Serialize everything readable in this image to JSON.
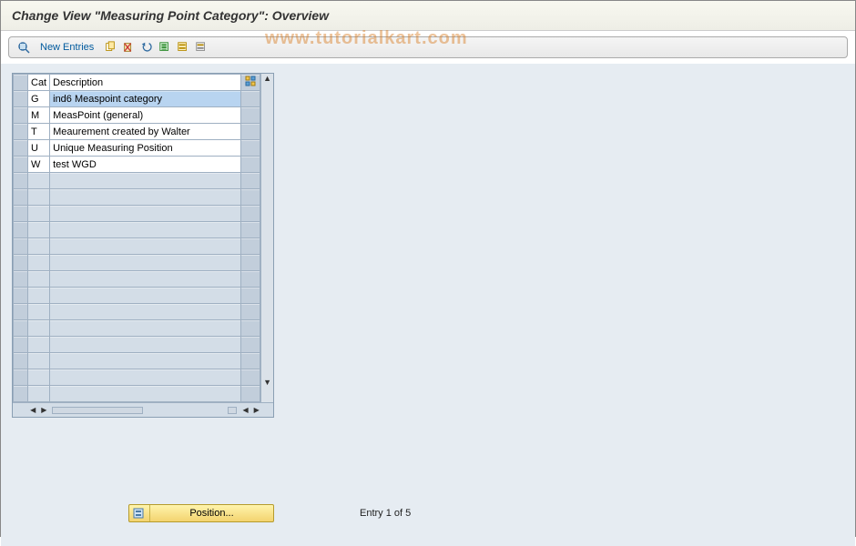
{
  "header": {
    "title": "Change View \"Measuring Point Category\": Overview"
  },
  "toolbar": {
    "new_entries_label": "New Entries",
    "icons": {
      "detail": "detail-icon",
      "copy": "copy-icon",
      "delete": "delete-icon",
      "undo": "undo-icon",
      "select_all": "select-all-icon",
      "select_block": "select-block-icon",
      "deselect": "deselect-icon"
    }
  },
  "table": {
    "headers": {
      "cat": "Cat",
      "description": "Description"
    },
    "config_icon": "table-settings-icon",
    "rows": [
      {
        "cat": "G",
        "description": "ind6 Measpoint category",
        "selected": true
      },
      {
        "cat": "M",
        "description": "MeasPoint (general)",
        "selected": false
      },
      {
        "cat": "T",
        "description": "Meaurement created by Walter",
        "selected": false
      },
      {
        "cat": "U",
        "description": "Unique Measuring Position",
        "selected": false
      },
      {
        "cat": "W",
        "description": "test WGD",
        "selected": false
      }
    ],
    "empty_rows": 14
  },
  "footer": {
    "position_label": "Position...",
    "entry_text": "Entry 1 of 5"
  },
  "watermark": "www.tutorialkart.com"
}
